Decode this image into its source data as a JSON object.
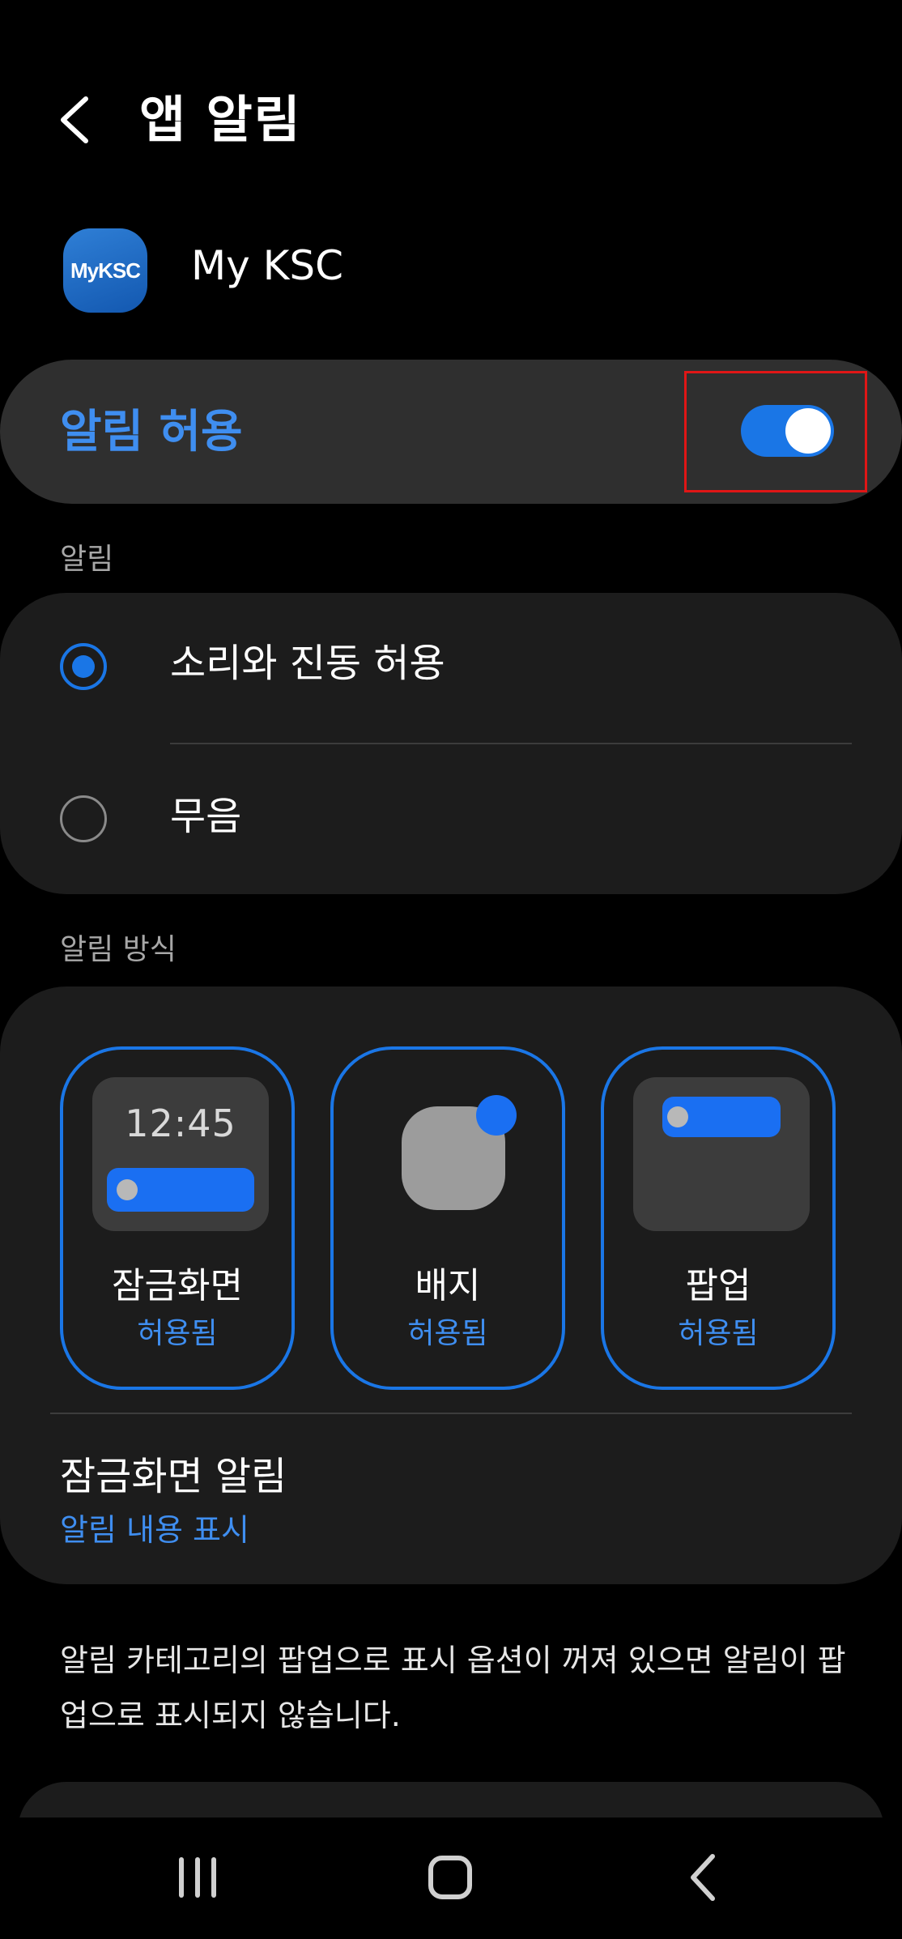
{
  "header": {
    "title": "앱 알림",
    "back_icon": "chevron-left-icon"
  },
  "app": {
    "name": "My KSC",
    "icon_text": "MyKSC"
  },
  "allow": {
    "label": "알림 허용",
    "enabled": true
  },
  "sound_section": {
    "label": "알림",
    "options": [
      {
        "label": "소리와 진동 허용",
        "selected": true
      },
      {
        "label": "무음",
        "selected": false
      }
    ]
  },
  "style_section": {
    "label": "알림 방식",
    "tiles": [
      {
        "title": "잠금화면",
        "status": "허용됨",
        "clock": "12:45"
      },
      {
        "title": "배지",
        "status": "허용됨"
      },
      {
        "title": "팝업",
        "status": "허용됨"
      }
    ]
  },
  "lockscreen": {
    "title": "잠금화면 알림",
    "value": "알림 내용 표시"
  },
  "info": "알림 카테고리의 팝업으로 표시 옵션이 꺼져 있으면 알림이 팝업으로 표시되지 않습니다.",
  "colors": {
    "accent": "#1a76e6",
    "accent_text": "#3f8ef0",
    "highlight": "#e01616"
  },
  "navbar": {
    "recents_icon": "recents-icon",
    "home_icon": "home-icon",
    "back_icon": "back-icon"
  }
}
